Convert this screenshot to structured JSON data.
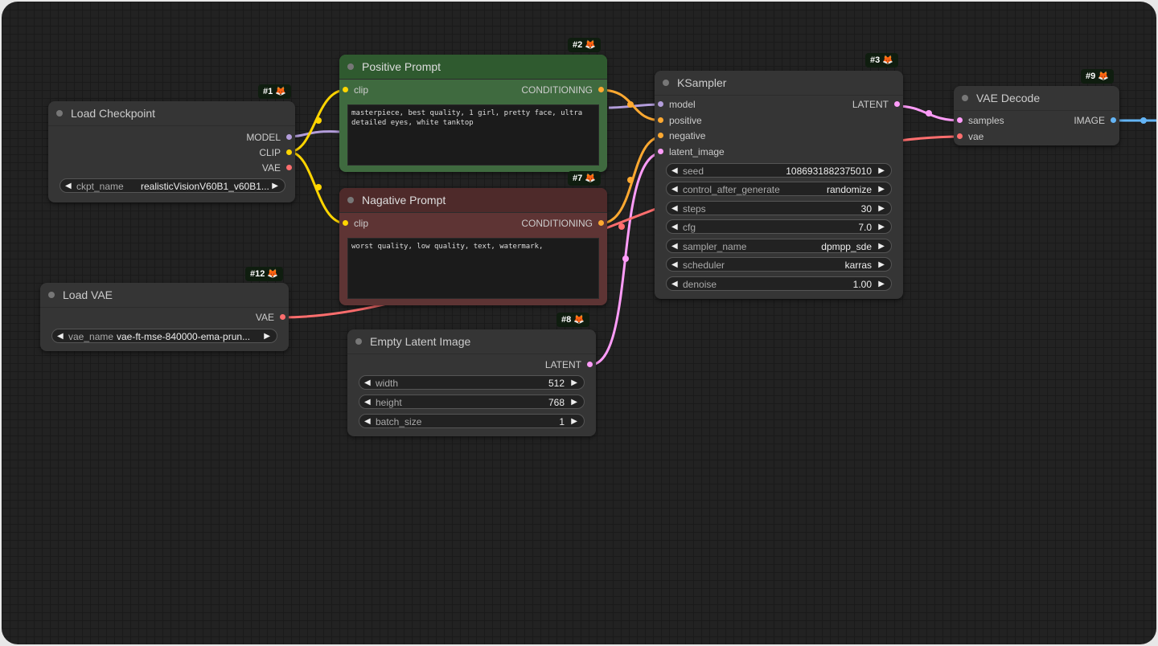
{
  "colors": {
    "canvas": "#222222",
    "node": "#353535",
    "positive_node": "#3f6a3f",
    "negative_node": "#5e3434",
    "model_wire": "#b39ddb",
    "clip_wire": "#ffd500",
    "vae_wire": "#ff6e6e",
    "conditioning_wire": "#ffa931",
    "latent_wire": "#ff9cf9",
    "image_wire": "#64b5f6"
  },
  "nodes": {
    "load_checkpoint": {
      "badge": "#1",
      "title": "Load Checkpoint",
      "outputs": [
        "MODEL",
        "CLIP",
        "VAE"
      ],
      "widget": {
        "label": "ckpt_name",
        "value": "realisticVisionV60B1_v60B1..."
      }
    },
    "load_vae": {
      "badge": "#12",
      "title": "Load VAE",
      "outputs": [
        "VAE"
      ],
      "widget": {
        "label": "vae_name",
        "value": "vae-ft-mse-840000-ema-prun..."
      }
    },
    "positive_prompt": {
      "badge": "#2",
      "title": "Positive Prompt",
      "input": "clip",
      "output": "CONDITIONING",
      "text": "masterpiece, best quality, 1 girl, pretty face, ultra detailed eyes, white tanktop"
    },
    "negative_prompt": {
      "badge": "#7",
      "title": "Nagative Prompt",
      "input": "clip",
      "output": "CONDITIONING",
      "text": "worst quality, low quality, text, watermark,"
    },
    "empty_latent": {
      "badge": "#8",
      "title": "Empty Latent Image",
      "output": "LATENT",
      "widgets": [
        {
          "label": "width",
          "value": "512"
        },
        {
          "label": "height",
          "value": "768"
        },
        {
          "label": "batch_size",
          "value": "1"
        }
      ]
    },
    "ksampler": {
      "badge": "#3",
      "title": "KSampler",
      "inputs": [
        "model",
        "positive",
        "negative",
        "latent_image"
      ],
      "output": "LATENT",
      "widgets": [
        {
          "label": "seed",
          "value": "1086931882375010"
        },
        {
          "label": "control_after_generate",
          "value": "randomize"
        },
        {
          "label": "steps",
          "value": "30"
        },
        {
          "label": "cfg",
          "value": "7.0"
        },
        {
          "label": "sampler_name",
          "value": "dpmpp_sde"
        },
        {
          "label": "scheduler",
          "value": "karras"
        },
        {
          "label": "denoise",
          "value": "1.00"
        }
      ]
    },
    "vae_decode": {
      "badge": "#9",
      "title": "VAE Decode",
      "inputs": [
        "samples",
        "vae"
      ],
      "output": "IMAGE"
    }
  }
}
